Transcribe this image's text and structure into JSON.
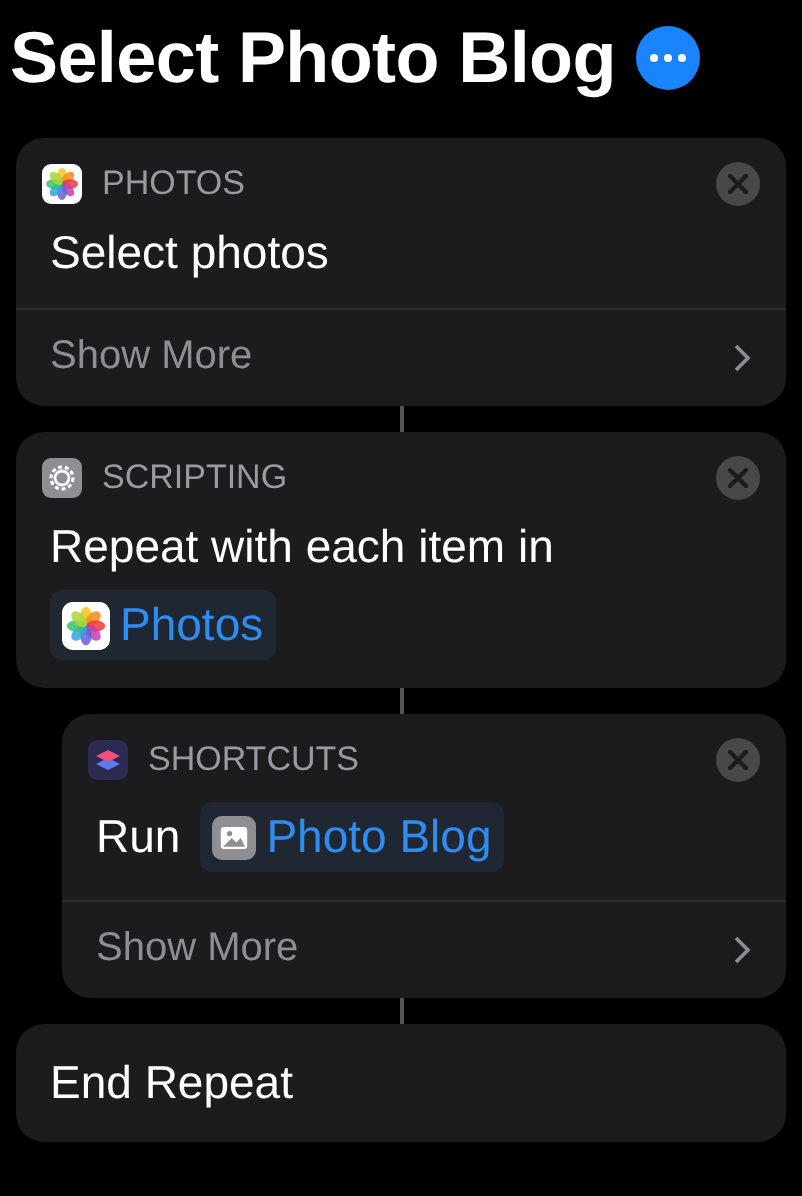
{
  "title": "Select Photo Blog",
  "actions": [
    {
      "kind": "action",
      "category": "PHOTOS",
      "indented": false,
      "body": [
        {
          "kind": "text",
          "text": "Select photos"
        }
      ],
      "show_more": "Show More"
    },
    {
      "kind": "action",
      "category": "SCRIPTING",
      "indented": false,
      "body": [
        {
          "kind": "text",
          "text": "Repeat with each item in"
        },
        {
          "kind": "token",
          "text": "Photos"
        }
      ]
    },
    {
      "kind": "action",
      "category": "SHORTCUTS",
      "indented": true,
      "body": [
        {
          "kind": "text",
          "text": "Run"
        },
        {
          "kind": "token",
          "text": "Photo Blog"
        }
      ],
      "show_more": "Show More"
    },
    {
      "kind": "end",
      "text": "End Repeat",
      "indented": false
    }
  ]
}
